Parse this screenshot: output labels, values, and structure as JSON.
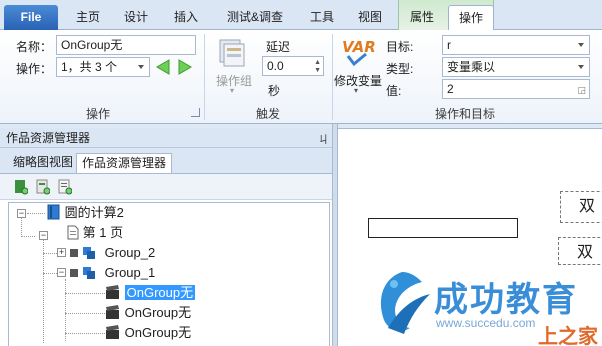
{
  "tabs": {
    "file": "File",
    "home": "主页",
    "design": "设计",
    "insert": "插入",
    "test": "测试&调查",
    "tools": "工具",
    "view": "视图",
    "properties": "属性",
    "operation": "操作"
  },
  "ribbon": {
    "name_label": "名称：",
    "name_value": "OnGroup无",
    "op_label": "操作：",
    "op_value": "1，共 3 个",
    "op_group_label": "操作",
    "action_group_btn": "操作组",
    "delay_label": "延迟",
    "delay_value": "0.0",
    "seconds_label": "秒",
    "trigger_group_label": "触发",
    "var_icon_text": "VAR",
    "modify_var_label": "修改变量",
    "target_label": "目标:",
    "target_value": "r",
    "type_label": "类型:",
    "type_value": "变量乘以",
    "value_label": "值:",
    "value_value": "2",
    "op_target_group_label": "操作和目标"
  },
  "left_panel": {
    "title": "作品资源管理器",
    "pin": "ㄐ",
    "subtab_thumbnails": "缩略图视图",
    "subtab_explorer": "作品资源管理器",
    "tree": {
      "root": "圆的计算2",
      "page": "第 1 页",
      "group2": "Group_2",
      "group1": "Group_1",
      "item1": "OnGroup无",
      "item2": "OnGroup无",
      "item3": "OnGroup无"
    }
  },
  "canvas": {
    "text1": "双",
    "text2": "双"
  },
  "watermark": {
    "title": "成功教育",
    "url": "www.succedu.com",
    "logo2": "上之家"
  }
}
